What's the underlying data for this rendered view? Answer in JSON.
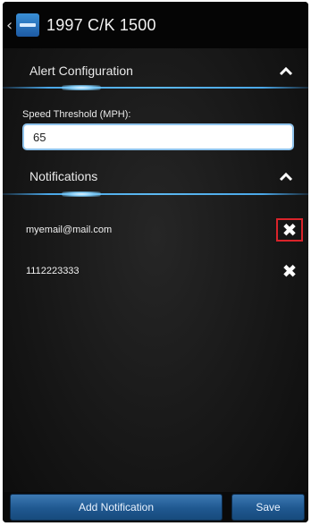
{
  "header": {
    "back_icon": "chevron-left",
    "app_icon": "car-app-icon",
    "title": "1997 C/K 1500"
  },
  "alert_configuration": {
    "title": "Alert Configuration",
    "expanded": true,
    "speed_threshold_label": "Speed Threshold (MPH):",
    "speed_threshold_value": "65"
  },
  "notifications": {
    "title": "Notifications",
    "expanded": true,
    "items": [
      {
        "value": "myemail@mail.com",
        "delete_highlighted": true
      },
      {
        "value": "1112223333",
        "delete_highlighted": false
      }
    ]
  },
  "actions": {
    "add_notification_label": "Add Notification",
    "save_label": "Save"
  },
  "colors": {
    "accent_blue": "#4aa7e8",
    "button_blue": "#1f5890",
    "highlight_red": "#d9232a"
  }
}
